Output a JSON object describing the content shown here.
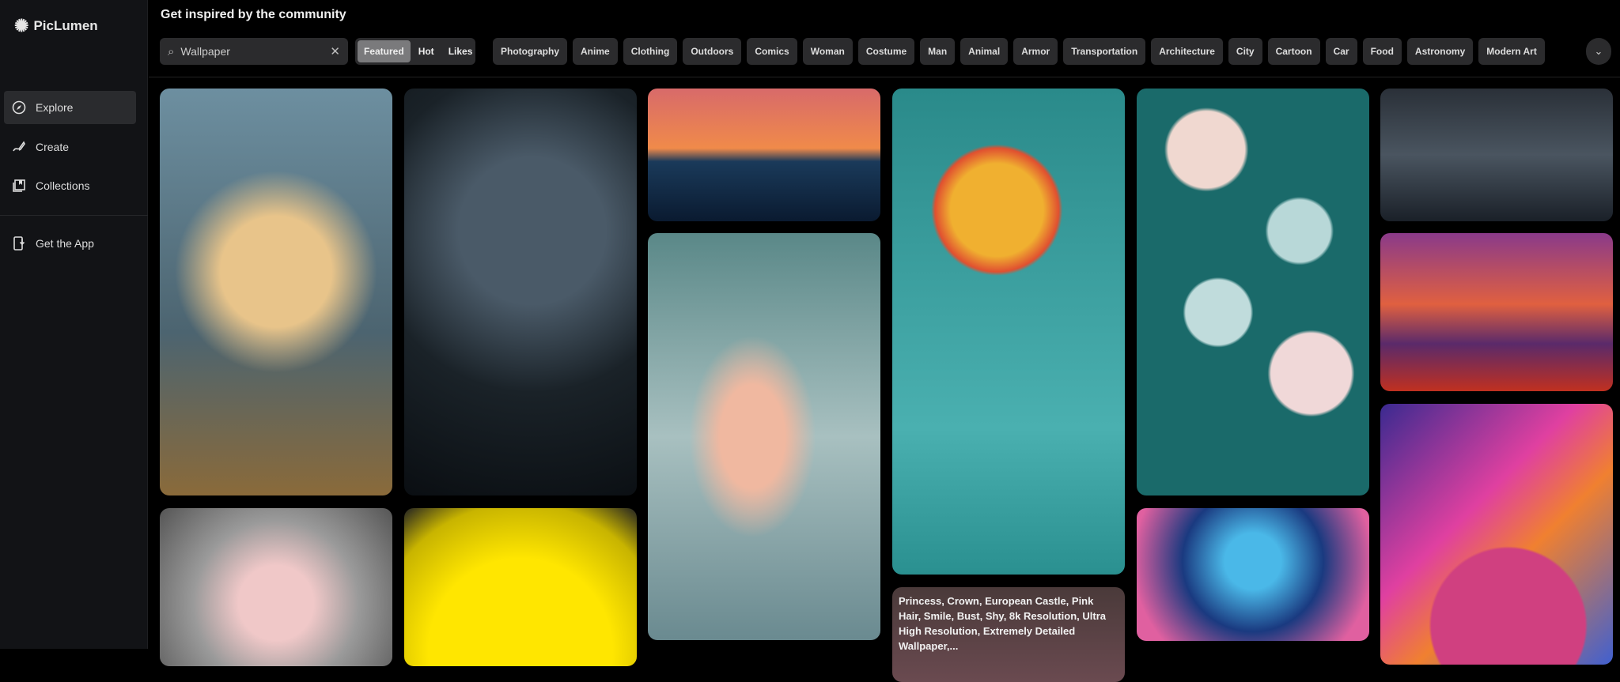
{
  "app": {
    "name": "PicLumen"
  },
  "sidebar": {
    "items": [
      {
        "label": "Explore",
        "icon": "compass-icon",
        "active": true
      },
      {
        "label": "Create",
        "icon": "brush-icon"
      },
      {
        "label": "Collections",
        "icon": "collections-icon"
      },
      {
        "label": "Get the App",
        "icon": "phone-download-icon"
      }
    ]
  },
  "header": {
    "title": "Get inspired by the community"
  },
  "search": {
    "value": "Wallpaper"
  },
  "sort_tabs": [
    {
      "label": "Featured",
      "active": true
    },
    {
      "label": "Hot"
    },
    {
      "label": "Likes"
    }
  ],
  "categories": [
    "Photography",
    "Anime",
    "Clothing",
    "Outdoors",
    "Comics",
    "Woman",
    "Costume",
    "Man",
    "Animal",
    "Armor",
    "Transportation",
    "Architecture",
    "City",
    "Cartoon",
    "Car",
    "Food",
    "Astronomy",
    "Modern Art"
  ],
  "gallery": {
    "caption": "Princess, Crown, European Castle, Pink Hair, Smile, Bust, Shy, 8k Resolution, Ultra High Resolution, Extremely Detailed Wallpaper,..."
  }
}
